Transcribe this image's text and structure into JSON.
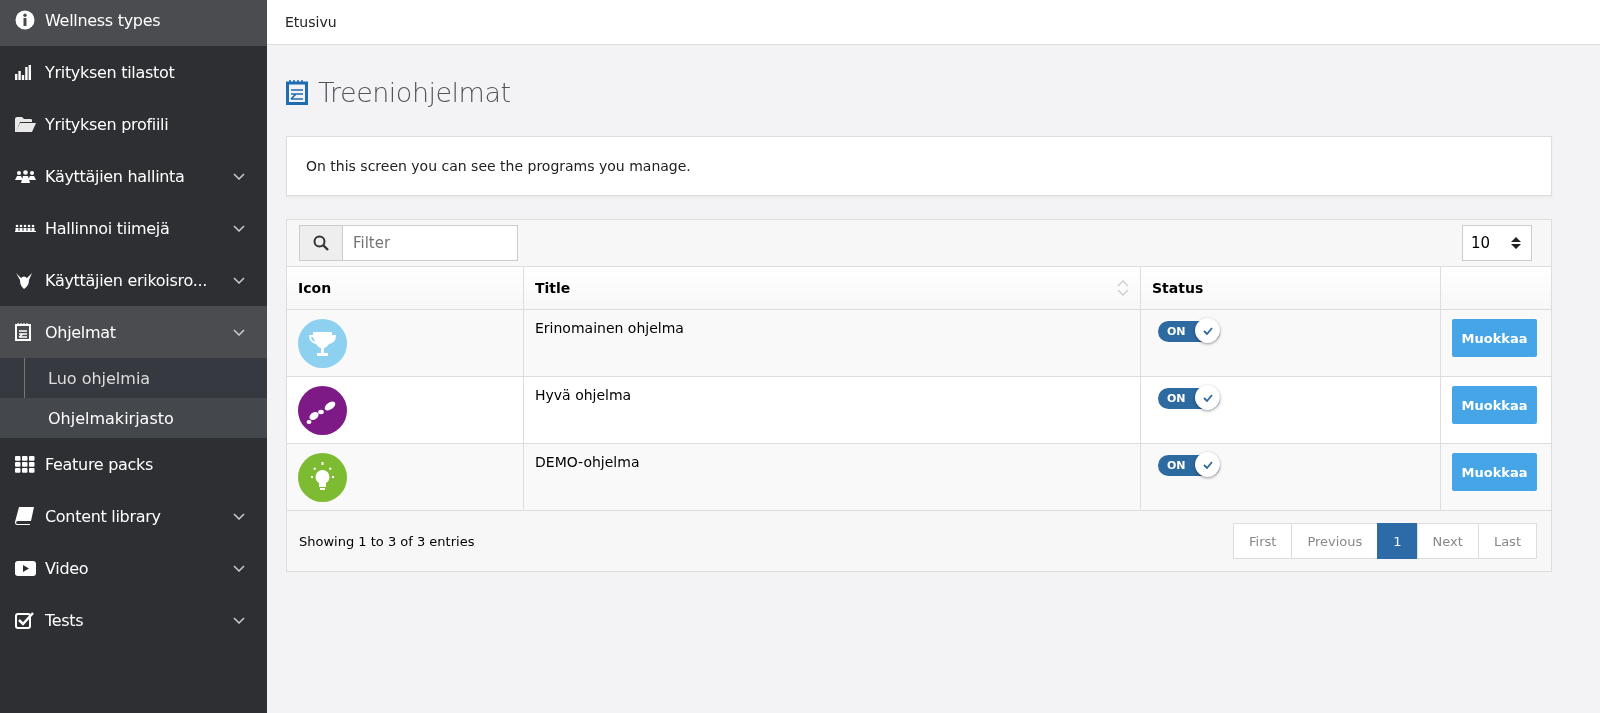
{
  "sidebar": {
    "items": [
      {
        "label": "Wellness types",
        "selected": true,
        "expandable": false
      },
      {
        "label": "Yrityksen tilastot",
        "selected": false,
        "expandable": false
      },
      {
        "label": "Yrityksen profiili",
        "selected": false,
        "expandable": false
      },
      {
        "label": "Käyttäjien hallinta",
        "selected": false,
        "expandable": true
      },
      {
        "label": "Hallinnoi tiimejä",
        "selected": false,
        "expandable": true
      },
      {
        "label": "Käyttäjien erikoisro...",
        "selected": false,
        "expandable": true
      },
      {
        "label": "Ohjelmat",
        "selected": true,
        "expandable": true,
        "expanded": true,
        "children": [
          {
            "label": "Luo ohjelmia",
            "selected": false
          },
          {
            "label": "Ohjelmakirjasto",
            "selected": true
          }
        ]
      },
      {
        "label": "Feature packs",
        "selected": false,
        "expandable": false
      },
      {
        "label": "Content library",
        "selected": false,
        "expandable": true
      },
      {
        "label": "Video",
        "selected": false,
        "expandable": true
      },
      {
        "label": "Tests",
        "selected": false,
        "expandable": true
      }
    ]
  },
  "breadcrumb": "Etusivu",
  "page_title": "Treeniohjelmat",
  "info_text": "On this screen you can see the programs you manage.",
  "filter": {
    "placeholder": "Filter"
  },
  "page_size": "10",
  "table": {
    "columns": [
      {
        "label": "Icon",
        "sortable": false
      },
      {
        "label": "Title",
        "sortable": true
      },
      {
        "label": "Status",
        "sortable": false
      }
    ],
    "rows": [
      {
        "color": "#8dd0f0",
        "title": "Erinomainen ohjelma",
        "toggle_label": "ON",
        "on": true,
        "action": "Muokkaa"
      },
      {
        "color": "#7e1a86",
        "title": "Hyvä ohjelma",
        "toggle_label": "ON",
        "on": true,
        "action": "Muokkaa"
      },
      {
        "color": "#7dbb33",
        "title": "DEMO-ohjelma",
        "toggle_label": "ON",
        "on": true,
        "action": "Muokkaa"
      }
    ]
  },
  "summary": "Showing 1 to 3 of 3 entries",
  "pagination": [
    {
      "label": "First",
      "selected": false
    },
    {
      "label": "Previous",
      "selected": false
    },
    {
      "label": "1",
      "selected": true
    },
    {
      "label": "Next",
      "selected": false
    },
    {
      "label": "Last",
      "selected": false
    }
  ]
}
